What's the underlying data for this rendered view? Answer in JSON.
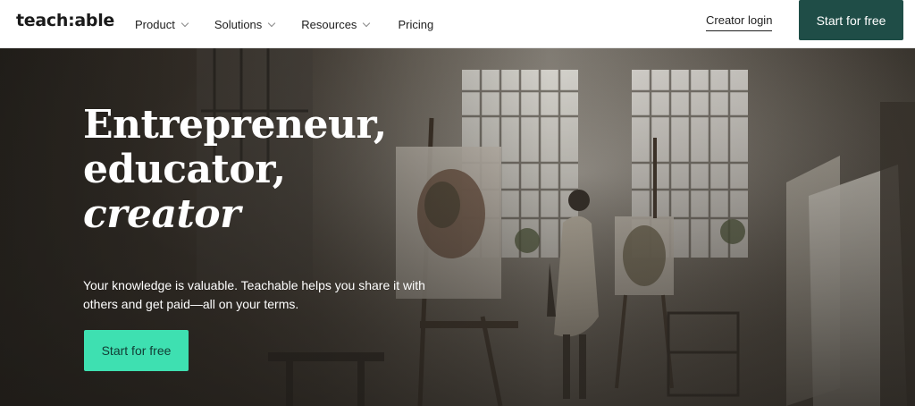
{
  "brand": {
    "logo_text": "teach:able"
  },
  "nav": {
    "items": [
      {
        "label": "Product",
        "has_dropdown": true
      },
      {
        "label": "Solutions",
        "has_dropdown": true
      },
      {
        "label": "Resources",
        "has_dropdown": true
      },
      {
        "label": "Pricing",
        "has_dropdown": false
      }
    ],
    "login_label": "Creator login",
    "cta_label": "Start for free"
  },
  "hero": {
    "headline_line1": "Entrepreneur,",
    "headline_line2": "educator,",
    "headline_line3": "creator",
    "subtext": "Your knowledge is valuable. Teachable helps you share it with others and get paid—all on your terms.",
    "cta_label": "Start for free",
    "background_scene": "artist-studio-photo"
  },
  "colors": {
    "nav_cta_bg": "#1f4d47",
    "hero_cta_bg": "#3ee0b1",
    "hero_text": "#ffffff"
  }
}
